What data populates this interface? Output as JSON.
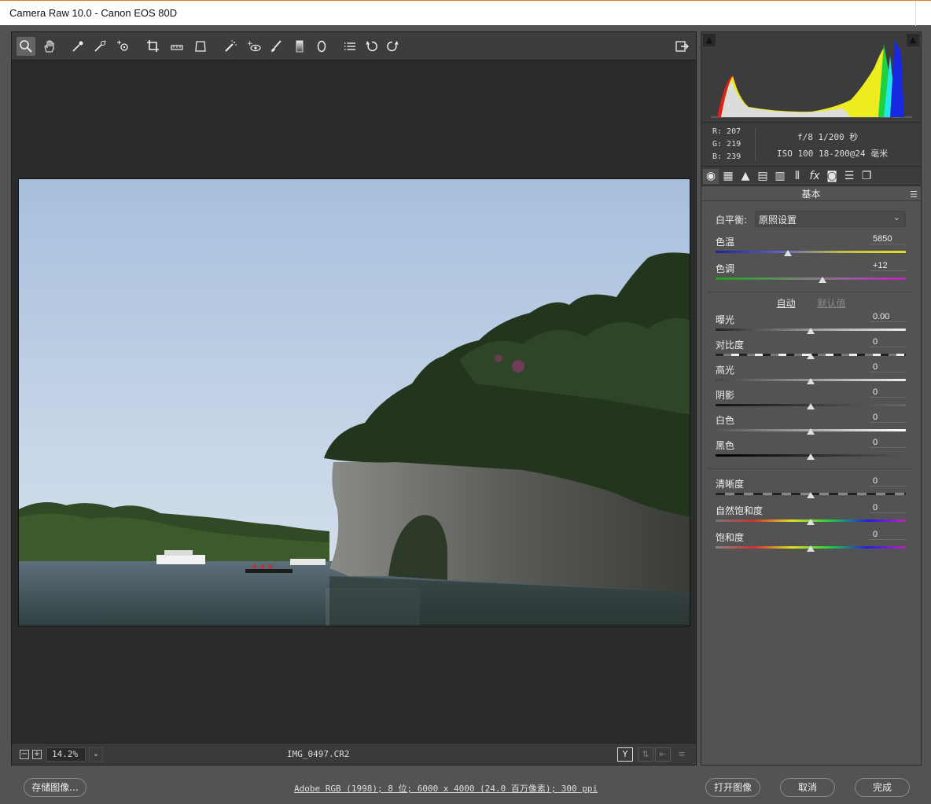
{
  "window": {
    "title": "Camera Raw 10.0 -  Canon EOS 80D"
  },
  "toolbar": {
    "tools": [
      "zoom-icon",
      "hand-icon",
      "white-balance-icon",
      "color-sampler-icon",
      "targeted-adjust-icon",
      "crop-icon",
      "straighten-icon",
      "transform-icon",
      "spot-removal-icon",
      "red-eye-icon",
      "adjustment-brush-icon",
      "graduated-filter-icon",
      "radial-filter-icon",
      "presets-list-icon",
      "rotate-ccw-icon",
      "rotate-cw-icon"
    ],
    "export_icon": "export-icon"
  },
  "status": {
    "zoom": "14.2%",
    "filename": "IMG_0497.CR2",
    "zoom_dropdown": "⌄"
  },
  "readout": {
    "r": "R:  207",
    "g": "G:  219",
    "b": "B:  239",
    "exif_line1": "f/8  1/200 秒",
    "exif_line2": "ISO 100  18-200@24 毫米"
  },
  "panel": {
    "section_title": "基本",
    "wb_label": "白平衡:",
    "wb_value": "原照设置",
    "auto_label": "自动",
    "default_label": "默认值"
  },
  "sliders": [
    {
      "label": "色温",
      "value": "5850",
      "level": 0.38
    },
    {
      "label": "色调",
      "value": "+12",
      "level": 0.56
    },
    {
      "label": "曝光",
      "value": "0.00",
      "level": 0.5
    },
    {
      "label": "对比度",
      "value": "0",
      "level": 0.5
    },
    {
      "label": "高光",
      "value": "0",
      "level": 0.5
    },
    {
      "label": "阴影",
      "value": "0",
      "level": 0.5
    },
    {
      "label": "白色",
      "value": "0",
      "level": 0.5
    },
    {
      "label": "黑色",
      "value": "0",
      "level": 0.5
    },
    {
      "label": "清晰度",
      "value": "0",
      "level": 0.5
    },
    {
      "label": "自然饱和度",
      "value": "0",
      "level": 0.5
    },
    {
      "label": "饱和度",
      "value": "0",
      "level": 0.5
    }
  ],
  "bottom": {
    "save_label": "存储图像...",
    "doc_info": "Adobe RGB (1998); 8 位; 6000 x 4000 (24.0 百万像素); 300 ppi",
    "open_label": "打开图像",
    "cancel_label": "取消",
    "done_label": "完成"
  },
  "colors": {
    "chrome": "#535353",
    "canvas": "#2b2b2b",
    "toolbar": "#3d3d3d",
    "accent": "#e07a2a"
  }
}
